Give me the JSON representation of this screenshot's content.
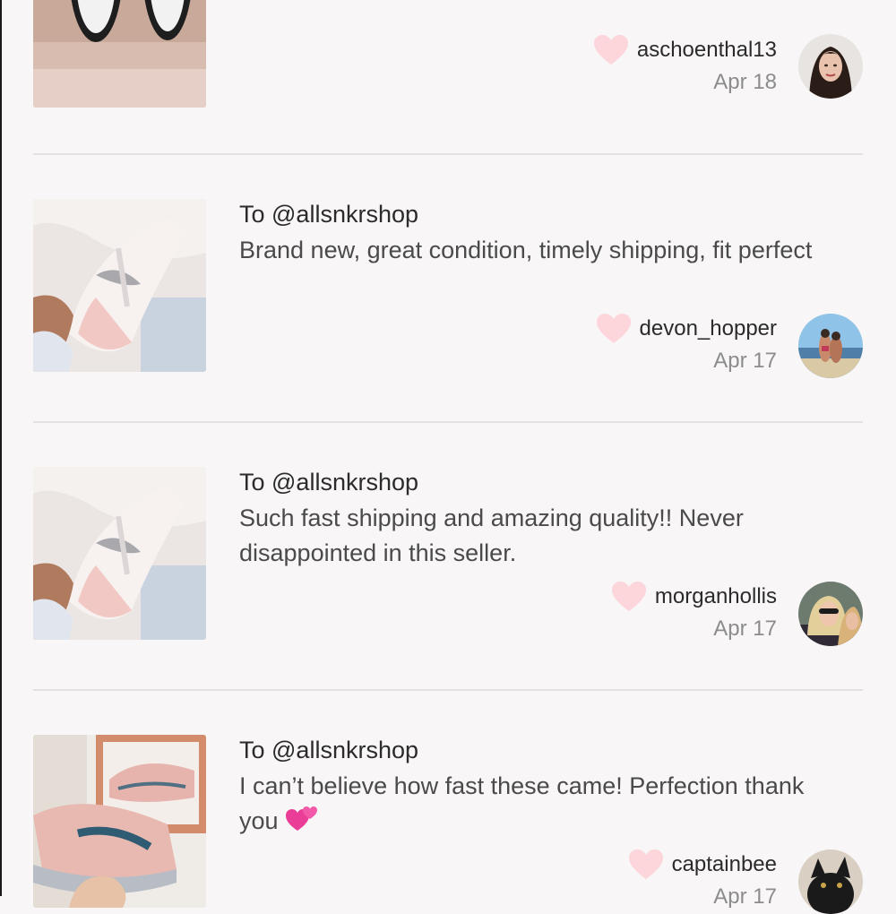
{
  "reviews": [
    {
      "to": "",
      "text": "",
      "username": "aschoenthal13",
      "date": "Apr 18",
      "heart_icon": "heart-icon",
      "image": "sneaker-photo-black-white"
    },
    {
      "to": "To @allsnkrshop",
      "text": "Brand new, great condition, timely shipping, fit perfect",
      "username": "devon_hopper",
      "date": "Apr 17",
      "heart_icon": "heart-icon",
      "image": "sneaker-photo-pink"
    },
    {
      "to": "To @allsnkrshop",
      "text": "Such fast shipping and amazing quality!! Never disappointed in this seller.",
      "username": "morganhollis",
      "date": "Apr 17",
      "heart_icon": "heart-icon",
      "image": "sneaker-photo-pink"
    },
    {
      "to": "To @allsnkrshop",
      "text": "I can’t believe how fast these came! Perfection thank you",
      "emoji": "two-hearts-icon",
      "username": "captainbee",
      "date": "Apr 17",
      "heart_icon": "heart-icon",
      "image": "sneaker-photo-pink-box"
    }
  ],
  "colors": {
    "background": "#f8f6f7",
    "heart": "#fcd6db",
    "text_primary": "#2b2b2b",
    "text_secondary": "#4a4a4a",
    "date": "#8c8c8c",
    "divider": "#e3e1e2"
  }
}
